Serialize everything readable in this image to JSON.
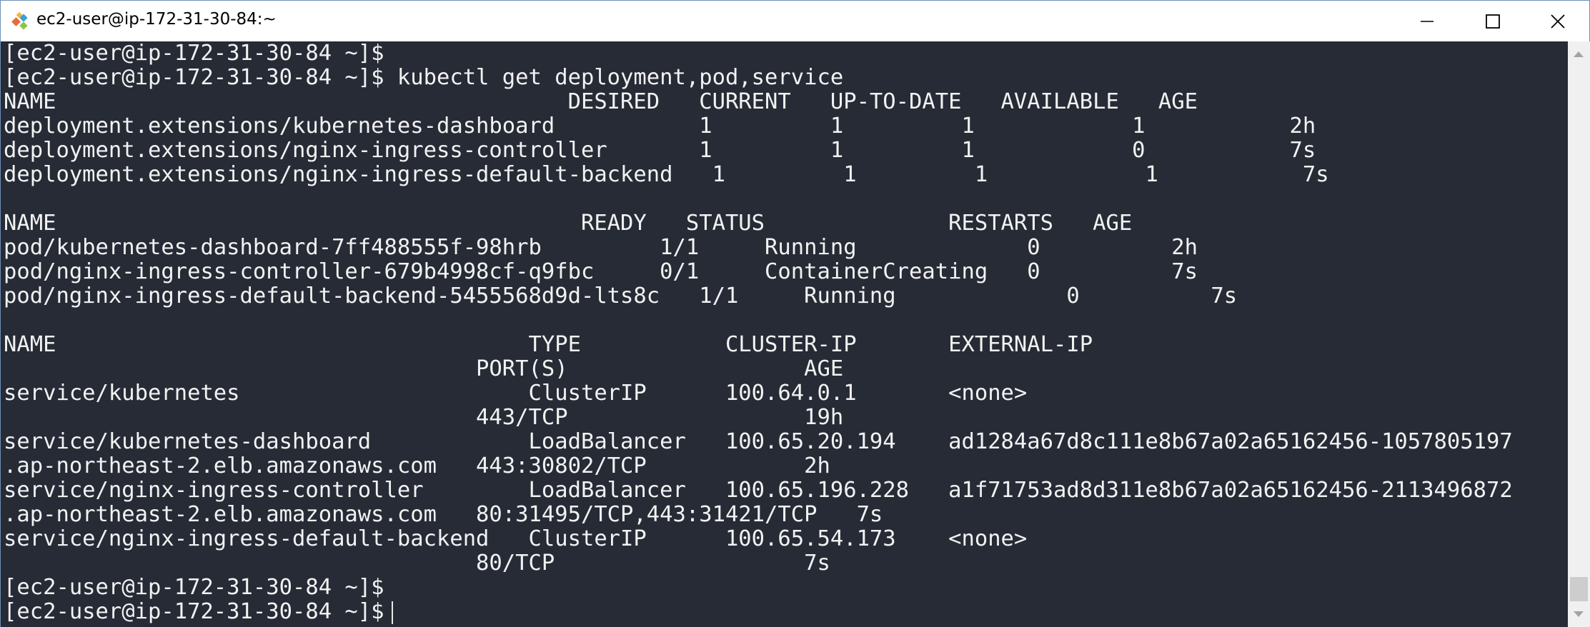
{
  "window": {
    "title": "ec2-user@ip-172-31-30-84:~",
    "app_icon": "putty-terminal-icon",
    "controls": {
      "minimize": "minimize-icon",
      "maximize": "maximize-icon",
      "close": "close-icon"
    }
  },
  "terminal": {
    "lines": [
      "[ec2-user@ip-172-31-30-84 ~]$",
      "[ec2-user@ip-172-31-30-84 ~]$ kubectl get deployment,pod,service",
      "NAME                                       DESIRED   CURRENT   UP-TO-DATE   AVAILABLE   AGE",
      "deployment.extensions/kubernetes-dashboard           1         1         1            1           2h",
      "deployment.extensions/nginx-ingress-controller       1         1         1            0           7s",
      "deployment.extensions/nginx-ingress-default-backend   1         1         1            1           7s",
      "",
      "NAME                                        READY   STATUS              RESTARTS   AGE",
      "pod/kubernetes-dashboard-7ff488555f-98hrb         1/1     Running             0          2h",
      "pod/nginx-ingress-controller-679b4998cf-q9fbc     0/1     ContainerCreating   0          7s",
      "pod/nginx-ingress-default-backend-5455568d9d-lts8c   1/1     Running             0          7s",
      "",
      "NAME                                    TYPE           CLUSTER-IP       EXTERNAL-IP",
      "                                    PORT(S)                  AGE",
      "service/kubernetes                      ClusterIP      100.64.0.1       <none>",
      "                                    443/TCP                  19h",
      "service/kubernetes-dashboard            LoadBalancer   100.65.20.194    ad1284a67d8c111e8b67a02a65162456-1057805197",
      ".ap-northeast-2.elb.amazonaws.com   443:30802/TCP            2h",
      "service/nginx-ingress-controller        LoadBalancer   100.65.196.228   a1f71753ad8d311e8b67a02a65162456-2113496872",
      ".ap-northeast-2.elb.amazonaws.com   80:31495/TCP,443:31421/TCP   7s",
      "service/nginx-ingress-default-backend   ClusterIP      100.65.54.173    <none>",
      "                                    80/TCP                   7s",
      "",
      "[ec2-user@ip-172-31-30-84 ~]$",
      "[ec2-user@ip-172-31-30-84 ~]$"
    ]
  },
  "scrollbar": {
    "up_icon": "scroll-up-arrow-icon",
    "down_icon": "scroll-down-arrow-icon"
  },
  "colors": {
    "terminal_background": "#262b36",
    "terminal_text": "#f2f2f2",
    "titlebar_background": "#ffffff"
  }
}
